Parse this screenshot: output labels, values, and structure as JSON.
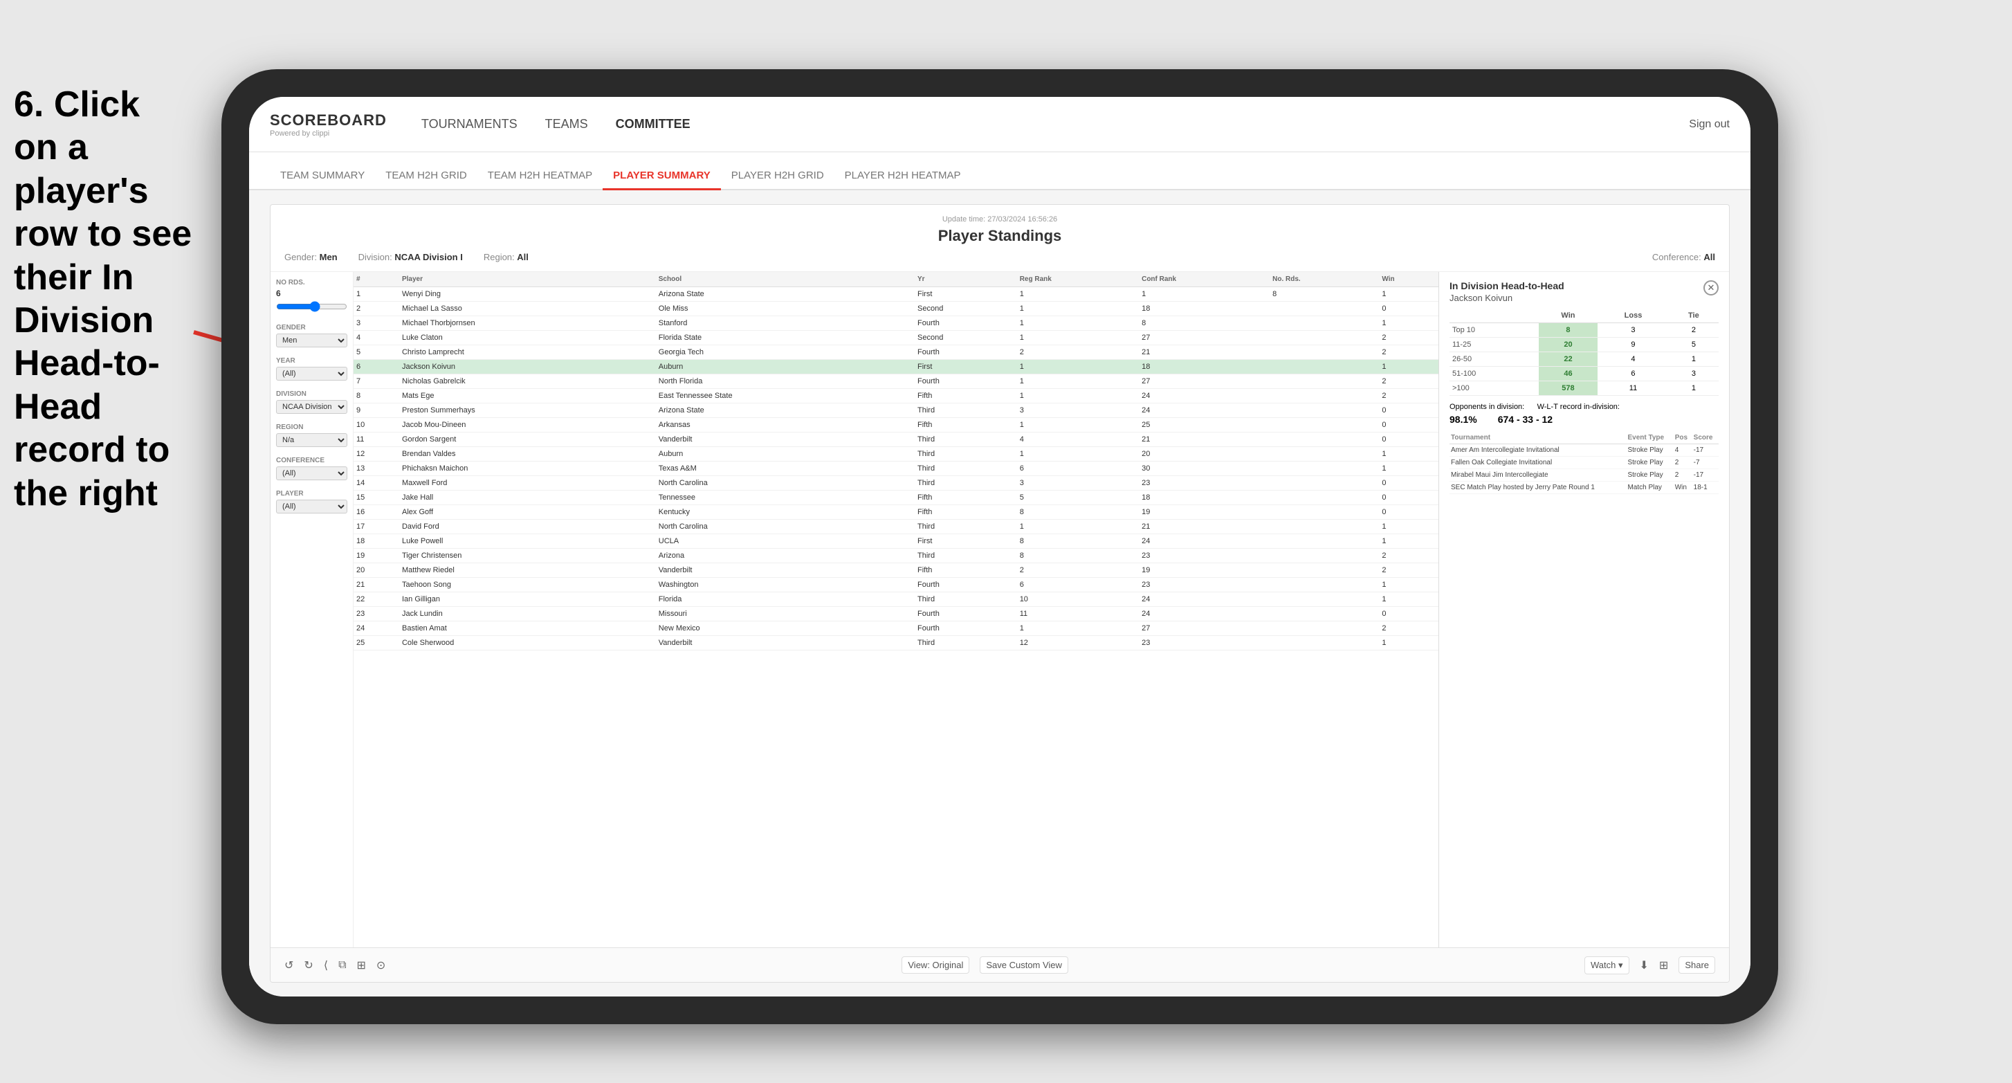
{
  "instruction": {
    "line1": "6. Click on a",
    "line2": "player's row to see",
    "line3": "their In Division",
    "line4": "Head-to-Head",
    "line5": "record to the right"
  },
  "app": {
    "logo": "SCOREBOARD",
    "logo_sub": "Powered by clippi",
    "sign_out": "Sign out"
  },
  "nav": {
    "items": [
      "TOURNAMENTS",
      "TEAMS",
      "COMMITTEE"
    ]
  },
  "sub_nav": {
    "items": [
      "TEAM SUMMARY",
      "TEAM H2H GRID",
      "TEAM H2H HEATMAP",
      "PLAYER SUMMARY",
      "PLAYER H2H GRID",
      "PLAYER H2H HEATMAP"
    ],
    "active": "PLAYER SUMMARY"
  },
  "dashboard": {
    "update_time": "Update time:",
    "update_date": "27/03/2024 16:56:26",
    "title": "Player Standings",
    "filters": {
      "gender_label": "Gender:",
      "gender_value": "Men",
      "division_label": "Division:",
      "division_value": "NCAA Division I",
      "region_label": "Region:",
      "region_value": "All",
      "conference_label": "Conference:",
      "conference_value": "All"
    },
    "sidebar_filters": {
      "no_rds_label": "No Rds.",
      "no_rds_value": "6",
      "gender_label": "Gender",
      "gender_value": "Men",
      "year_label": "Year",
      "year_value": "(All)",
      "division_label": "Division",
      "division_value": "NCAA Division I",
      "region_label": "Region",
      "region_value": "N/a",
      "conference_label": "Conference",
      "conference_value": "(All)",
      "player_label": "Player",
      "player_value": "(All)"
    },
    "table": {
      "columns": [
        "#",
        "Player",
        "School",
        "Yr",
        "Reg Rank",
        "Conf Rank",
        "No. Rds.",
        "Win"
      ],
      "rows": [
        {
          "rank": "1",
          "player": "Wenyi Ding",
          "school": "Arizona State",
          "year": "First",
          "reg_rank": "1",
          "conf_rank": "1",
          "no_rds": "8",
          "win": "1"
        },
        {
          "rank": "2",
          "player": "Michael La Sasso",
          "school": "Ole Miss",
          "year": "Second",
          "reg_rank": "1",
          "conf_rank": "18",
          "no_rds": "",
          "win": "0"
        },
        {
          "rank": "3",
          "player": "Michael Thorbjornsen",
          "school": "Stanford",
          "year": "Fourth",
          "reg_rank": "1",
          "conf_rank": "8",
          "no_rds": "",
          "win": "1"
        },
        {
          "rank": "4",
          "player": "Luke Claton",
          "school": "Florida State",
          "year": "Second",
          "reg_rank": "1",
          "conf_rank": "27",
          "no_rds": "",
          "win": "2"
        },
        {
          "rank": "5",
          "player": "Christo Lamprecht",
          "school": "Georgia Tech",
          "year": "Fourth",
          "reg_rank": "2",
          "conf_rank": "21",
          "no_rds": "",
          "win": "2"
        },
        {
          "rank": "6",
          "player": "Jackson Koivun",
          "school": "Auburn",
          "year": "First",
          "reg_rank": "1",
          "conf_rank": "18",
          "no_rds": "",
          "win": "1",
          "highlighted": true
        },
        {
          "rank": "7",
          "player": "Nicholas Gabrelcik",
          "school": "North Florida",
          "year": "Fourth",
          "reg_rank": "1",
          "conf_rank": "27",
          "no_rds": "",
          "win": "2"
        },
        {
          "rank": "8",
          "player": "Mats Ege",
          "school": "East Tennessee State",
          "year": "Fifth",
          "reg_rank": "1",
          "conf_rank": "24",
          "no_rds": "",
          "win": "2"
        },
        {
          "rank": "9",
          "player": "Preston Summerhays",
          "school": "Arizona State",
          "year": "Third",
          "reg_rank": "3",
          "conf_rank": "24",
          "no_rds": "",
          "win": "0"
        },
        {
          "rank": "10",
          "player": "Jacob Mou-Dineen",
          "school": "Arkansas",
          "year": "Fifth",
          "reg_rank": "1",
          "conf_rank": "25",
          "no_rds": "",
          "win": "0"
        },
        {
          "rank": "11",
          "player": "Gordon Sargent",
          "school": "Vanderbilt",
          "year": "Third",
          "reg_rank": "4",
          "conf_rank": "21",
          "no_rds": "",
          "win": "0"
        },
        {
          "rank": "12",
          "player": "Brendan Valdes",
          "school": "Auburn",
          "year": "Third",
          "reg_rank": "1",
          "conf_rank": "20",
          "no_rds": "",
          "win": "1"
        },
        {
          "rank": "13",
          "player": "Phichaksn Maichon",
          "school": "Texas A&M",
          "year": "Third",
          "reg_rank": "6",
          "conf_rank": "30",
          "no_rds": "",
          "win": "1"
        },
        {
          "rank": "14",
          "player": "Maxwell Ford",
          "school": "North Carolina",
          "year": "Third",
          "reg_rank": "3",
          "conf_rank": "23",
          "no_rds": "",
          "win": "0"
        },
        {
          "rank": "15",
          "player": "Jake Hall",
          "school": "Tennessee",
          "year": "Fifth",
          "reg_rank": "5",
          "conf_rank": "18",
          "no_rds": "",
          "win": "0"
        },
        {
          "rank": "16",
          "player": "Alex Goff",
          "school": "Kentucky",
          "year": "Fifth",
          "reg_rank": "8",
          "conf_rank": "19",
          "no_rds": "",
          "win": "0"
        },
        {
          "rank": "17",
          "player": "David Ford",
          "school": "North Carolina",
          "year": "Third",
          "reg_rank": "1",
          "conf_rank": "21",
          "no_rds": "",
          "win": "1"
        },
        {
          "rank": "18",
          "player": "Luke Powell",
          "school": "UCLA",
          "year": "First",
          "reg_rank": "8",
          "conf_rank": "24",
          "no_rds": "",
          "win": "1"
        },
        {
          "rank": "19",
          "player": "Tiger Christensen",
          "school": "Arizona",
          "year": "Third",
          "reg_rank": "8",
          "conf_rank": "23",
          "no_rds": "",
          "win": "2"
        },
        {
          "rank": "20",
          "player": "Matthew Riedel",
          "school": "Vanderbilt",
          "year": "Fifth",
          "reg_rank": "2",
          "conf_rank": "19",
          "no_rds": "",
          "win": "2"
        },
        {
          "rank": "21",
          "player": "Taehoon Song",
          "school": "Washington",
          "year": "Fourth",
          "reg_rank": "6",
          "conf_rank": "23",
          "no_rds": "",
          "win": "1"
        },
        {
          "rank": "22",
          "player": "Ian Gilligan",
          "school": "Florida",
          "year": "Third",
          "reg_rank": "10",
          "conf_rank": "24",
          "no_rds": "",
          "win": "1"
        },
        {
          "rank": "23",
          "player": "Jack Lundin",
          "school": "Missouri",
          "year": "Fourth",
          "reg_rank": "11",
          "conf_rank": "24",
          "no_rds": "",
          "win": "0"
        },
        {
          "rank": "24",
          "player": "Bastien Amat",
          "school": "New Mexico",
          "year": "Fourth",
          "reg_rank": "1",
          "conf_rank": "27",
          "no_rds": "",
          "win": "2"
        },
        {
          "rank": "25",
          "player": "Cole Sherwood",
          "school": "Vanderbilt",
          "year": "Third",
          "reg_rank": "12",
          "conf_rank": "23",
          "no_rds": "",
          "win": "1"
        }
      ]
    },
    "h2h": {
      "title": "In Division Head-to-Head",
      "player_name": "Jackson Koivun",
      "col_headers": [
        "",
        "Win",
        "Loss",
        "Tie"
      ],
      "rows": [
        {
          "label": "Top 10",
          "win": "8",
          "loss": "3",
          "tie": "2",
          "win_class": "win-cell"
        },
        {
          "label": "11-25",
          "win": "20",
          "loss": "9",
          "tie": "5",
          "win_class": "win-cell"
        },
        {
          "label": "26-50",
          "win": "22",
          "loss": "4",
          "tie": "1",
          "win_class": "win-cell"
        },
        {
          "label": "51-100",
          "win": "46",
          "loss": "6",
          "tie": "3",
          "win_class": "win-cell"
        },
        {
          "label": ">100",
          "win": "578",
          "loss": "11",
          "tie": "1",
          "win_class": "win-cell"
        }
      ],
      "opponents_label": "Opponents in division:",
      "wl_label": "W-L-T record in-division:",
      "pct": "98.1%",
      "record": "674 - 33 - 12",
      "event_table": {
        "columns": [
          "Tournament",
          "Event Type",
          "Pos",
          "Score"
        ],
        "rows": [
          {
            "tournament": "Amer Am Intercollegiate Invitational",
            "event_type": "Stroke Play",
            "pos": "4",
            "score": "-17"
          },
          {
            "tournament": "Fallen Oak Collegiate Invitational",
            "event_type": "Stroke Play",
            "pos": "2",
            "score": "-7"
          },
          {
            "tournament": "Mirabel Maui Jim Intercollegiate",
            "event_type": "Stroke Play",
            "pos": "2",
            "score": "-17"
          },
          {
            "tournament": "SEC Match Play hosted by Jerry Pate Round 1",
            "event_type": "Match Play",
            "pos": "Win",
            "score": "18-1"
          }
        ]
      }
    }
  },
  "toolbar": {
    "view_original": "View: Original",
    "save_custom_view": "Save Custom View",
    "watch": "Watch ▾",
    "share": "Share"
  }
}
